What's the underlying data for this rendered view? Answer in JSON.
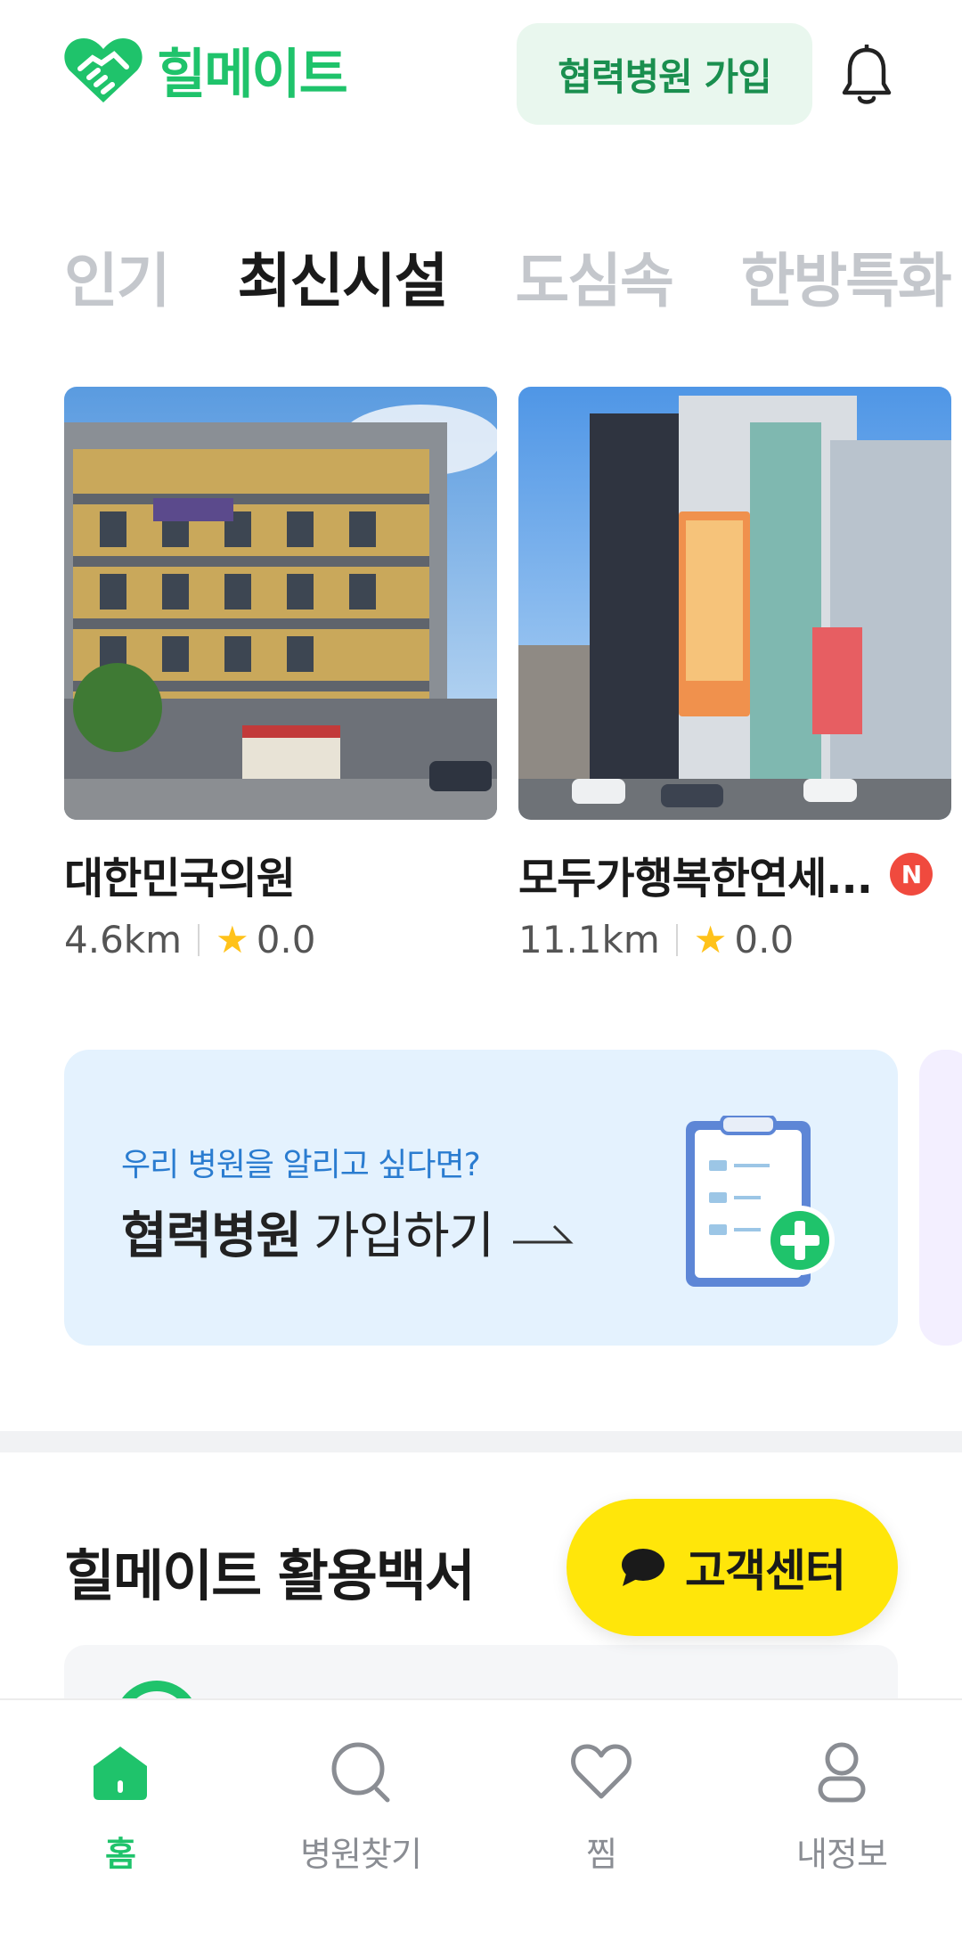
{
  "header": {
    "brand": "힐메이트",
    "join_button": "협력병원 가입",
    "bell_icon": "bell-icon"
  },
  "tabs": [
    {
      "label": "인기",
      "active": false
    },
    {
      "label": "최신시설",
      "active": true
    },
    {
      "label": "도심속",
      "active": false
    },
    {
      "label": "한방특화",
      "active": false
    }
  ],
  "cards": [
    {
      "name": "대한민국의원",
      "distance": "4.6km",
      "rating": "0.0",
      "new_badge": ""
    },
    {
      "name": "모두가행복한연세...",
      "distance": "11.1km",
      "rating": "0.0",
      "new_badge": "N"
    }
  ],
  "banner": {
    "subtitle": "우리 병원을 알리고 싶다면?",
    "title_bold": "협력병원",
    "title_rest": "가입하기"
  },
  "section": {
    "title": "힐메이트 활용백서"
  },
  "cs_button": {
    "label": "고객센터"
  },
  "bottom_nav": [
    {
      "label": "홈",
      "icon": "home-icon",
      "active": true
    },
    {
      "label": "병원찾기",
      "icon": "search-icon",
      "active": false
    },
    {
      "label": "찜",
      "icon": "heart-icon",
      "active": false
    },
    {
      "label": "내정보",
      "icon": "user-icon",
      "active": false
    }
  ],
  "colors": {
    "brand_green": "#1fc36b",
    "banner_bg": "#e4f2fe",
    "cs_yellow": "#ffe60a",
    "new_badge_red": "#f04a3e"
  }
}
